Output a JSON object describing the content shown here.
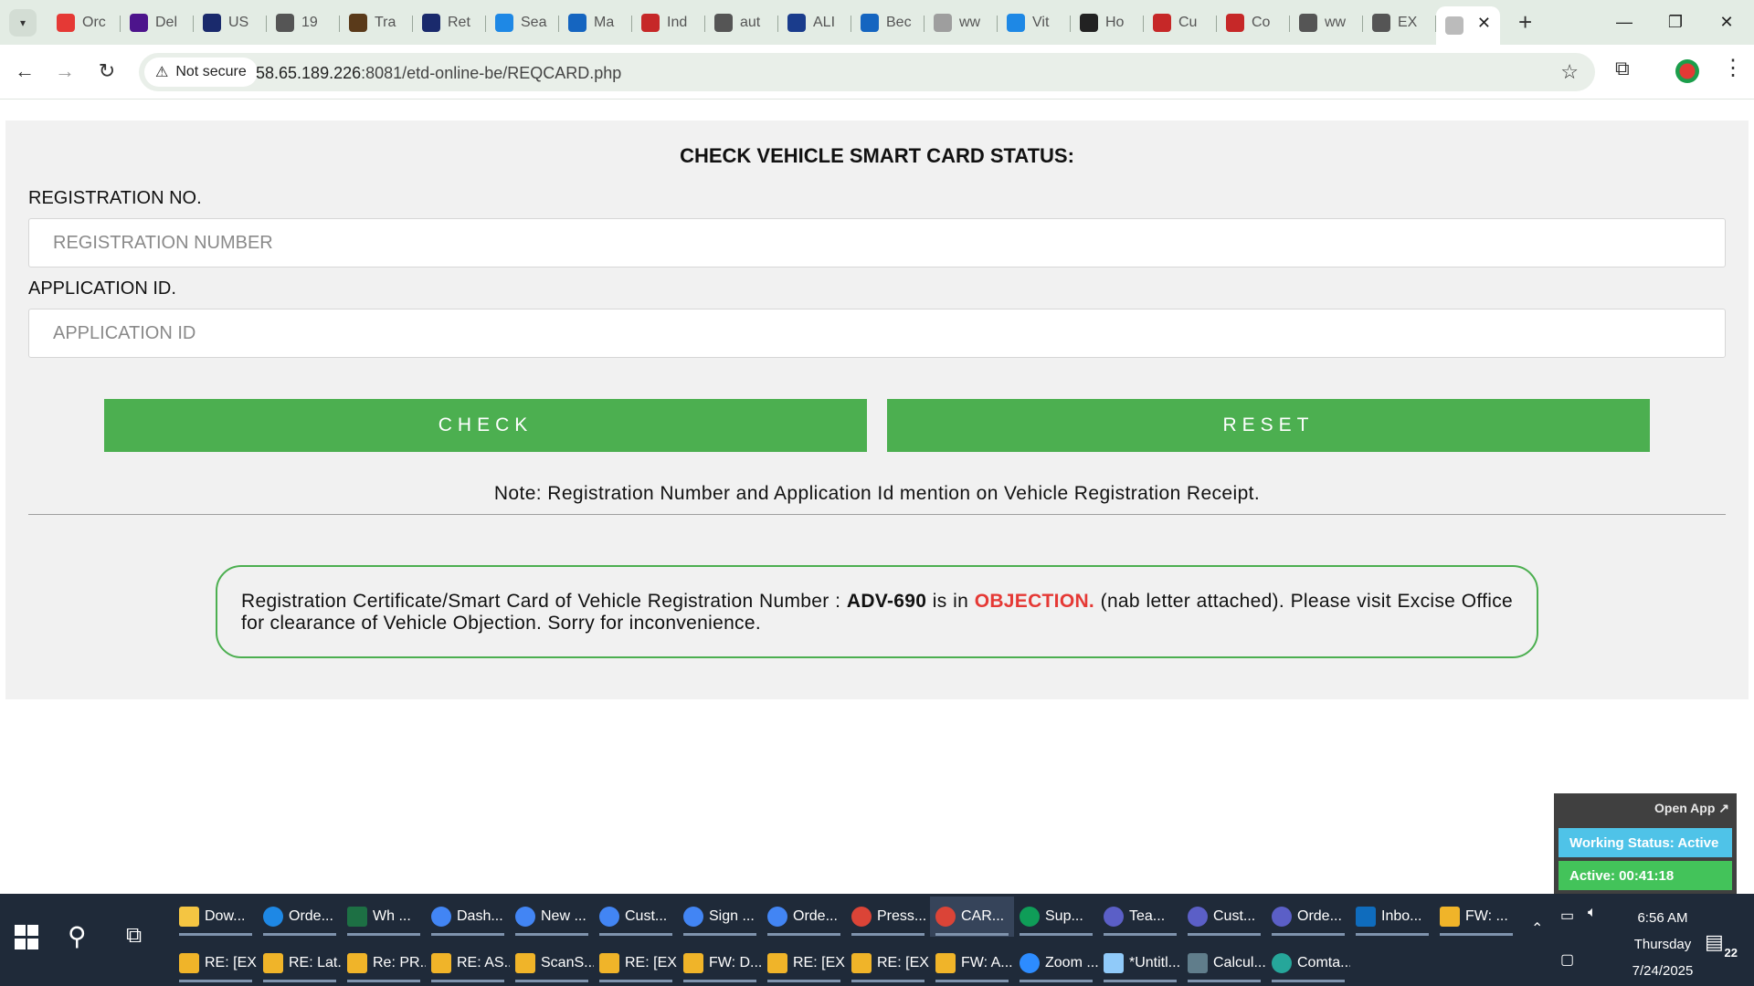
{
  "browser": {
    "tabs": [
      {
        "label": "Orc",
        "icon": "red-swirl-icon",
        "color": "#e53935"
      },
      {
        "label": "Del",
        "icon": "fedex-icon",
        "color": "#4d148c"
      },
      {
        "label": "US",
        "icon": "usps-eagle-icon",
        "color": "#1a2a6c"
      },
      {
        "label": "19",
        "icon": "globe-icon",
        "color": "#555555"
      },
      {
        "label": "Tra",
        "icon": "ups-shield-icon",
        "color": "#5a3a1a"
      },
      {
        "label": "Ret",
        "icon": "checkmark-logo-icon",
        "color": "#1a2a6c"
      },
      {
        "label": "Sea",
        "icon": "swoosh-logo-icon",
        "color": "#1e88e5"
      },
      {
        "label": "Ma",
        "icon": "outlook-icon",
        "color": "#1565c0"
      },
      {
        "label": "Ind",
        "icon": "stripes-logo-icon",
        "color": "#c62828"
      },
      {
        "label": "aut",
        "icon": "globe-icon",
        "color": "#555555"
      },
      {
        "label": "ALI",
        "icon": "seventeen-track-icon",
        "color": "#1a3c8c"
      },
      {
        "label": "Bec",
        "icon": "f-logo-icon",
        "color": "#1565c0"
      },
      {
        "label": "ww",
        "icon": "loading-spinner-icon",
        "color": "#9e9e9e"
      },
      {
        "label": "Vit",
        "icon": "dollar-circle-icon",
        "color": "#1e88e5"
      },
      {
        "label": "Ho",
        "icon": "x-logo-icon",
        "color": "#222222"
      },
      {
        "label": "Cu",
        "icon": "red-arc-icon",
        "color": "#c62828"
      },
      {
        "label": "Co",
        "icon": "red-arc-icon",
        "color": "#c62828"
      },
      {
        "label": "ww",
        "icon": "circle-m-icon",
        "color": "#555555"
      },
      {
        "label": "EX",
        "icon": "globe-icon",
        "color": "#555555"
      },
      {
        "label": "",
        "icon": "loading-icon",
        "color": "#bbbbbb"
      }
    ],
    "security_label": "Not secure",
    "url_host": "58.65.189.226",
    "url_path": ":8081/etd-online-be/REQCARD.php"
  },
  "page": {
    "title": "CHECK VEHICLE SMART CARD STATUS:",
    "registration_label": "REGISTRATION NO.",
    "registration_placeholder": "REGISTRATION NUMBER",
    "registration_value": "",
    "application_label": "APPLICATION ID.",
    "application_placeholder": "APPLICATION ID",
    "application_value": "",
    "check_label": "CHECK",
    "reset_label": "RESET",
    "note": "Note: Registration Number and Application Id mention on Vehicle Registration Receipt.",
    "status": {
      "prefix": "Registration Certificate/Smart Card of Vehicle Registration Number : ",
      "registration_number": "ADV-690",
      "middle": " is in ",
      "state": "OBJECTION.",
      "suffix": " (nab letter attached). Please visit Excise Office for clearance of Vehicle Objection. Sorry for inconvenience.",
      "state_color": "#e53935"
    }
  },
  "widget": {
    "open_app": "Open App ↗",
    "working_status": "Working Status: Active",
    "active_time": "Active: 00:41:18",
    "working_color": "#4fc3e8",
    "active_color": "#43c35a"
  },
  "taskbar": {
    "row1": [
      {
        "label": "Dow...",
        "icon": "file-explorer-icon",
        "color": "#f4c542"
      },
      {
        "label": "Orde...",
        "icon": "edge-icon",
        "color": "#1e88e5"
      },
      {
        "label": "Wh ...",
        "icon": "excel-icon",
        "color": "#1d7044"
      },
      {
        "label": "Dash...",
        "icon": "chrome-profile-icon",
        "color": "#4285f4"
      },
      {
        "label": "New ...",
        "icon": "chrome-profile-icon",
        "color": "#4285f4"
      },
      {
        "label": "Cust...",
        "icon": "chrome-profile-icon",
        "color": "#4285f4"
      },
      {
        "label": "Sign ...",
        "icon": "chrome-profile-icon",
        "color": "#4285f4"
      },
      {
        "label": "Orde...",
        "icon": "chrome-profile-icon",
        "color": "#4285f4"
      },
      {
        "label": "Press...",
        "icon": "chrome-icon",
        "color": "#db4437"
      },
      {
        "label": "CAR...",
        "icon": "chrome-icon",
        "color": "#db4437"
      },
      {
        "label": "Sup...",
        "icon": "chrome-icon",
        "color": "#0f9d58"
      },
      {
        "label": "Tea...",
        "icon": "teams-icon",
        "color": "#5b5fc7"
      },
      {
        "label": "Cust...",
        "icon": "teams-icon",
        "color": "#5b5fc7"
      },
      {
        "label": "Orde...",
        "icon": "teams-icon",
        "color": "#5b5fc7"
      },
      {
        "label": "Inbo...",
        "icon": "outlook-icon",
        "color": "#0f6cbd"
      },
      {
        "label": "FW: ...",
        "icon": "envelope-icon",
        "color": "#f0b429"
      }
    ],
    "row2": [
      {
        "label": "RE: [EX...",
        "icon": "envelope-icon",
        "color": "#f0b429"
      },
      {
        "label": "RE: Lat...",
        "icon": "envelope-icon",
        "color": "#f0b429"
      },
      {
        "label": "Re: PR...",
        "icon": "envelope-icon",
        "color": "#f0b429"
      },
      {
        "label": "RE: AS...",
        "icon": "envelope-icon",
        "color": "#f0b429"
      },
      {
        "label": "ScanS...",
        "icon": "envelope-icon",
        "color": "#f0b429"
      },
      {
        "label": "RE: [EX...",
        "icon": "envelope-icon",
        "color": "#f0b429"
      },
      {
        "label": "FW: D...",
        "icon": "envelope-icon",
        "color": "#f0b429"
      },
      {
        "label": "RE: [EX...",
        "icon": "envelope-icon",
        "color": "#f0b429"
      },
      {
        "label": "RE: [EX...",
        "icon": "envelope-icon",
        "color": "#f0b429"
      },
      {
        "label": "FW: A...",
        "icon": "envelope-icon",
        "color": "#f0b429"
      },
      {
        "label": "Zoom ...",
        "icon": "zoom-icon",
        "color": "#2d8cff"
      },
      {
        "label": "*Untitl...",
        "icon": "notepad-icon",
        "color": "#90caf9"
      },
      {
        "label": "Calcul...",
        "icon": "calculator-icon",
        "color": "#607d8b"
      },
      {
        "label": "Comta...",
        "icon": "comtalk-icon",
        "color": "#26a69a"
      }
    ],
    "time": "6:56 AM",
    "day": "Thursday",
    "date": "7/24/2025",
    "notification_count": "22"
  }
}
